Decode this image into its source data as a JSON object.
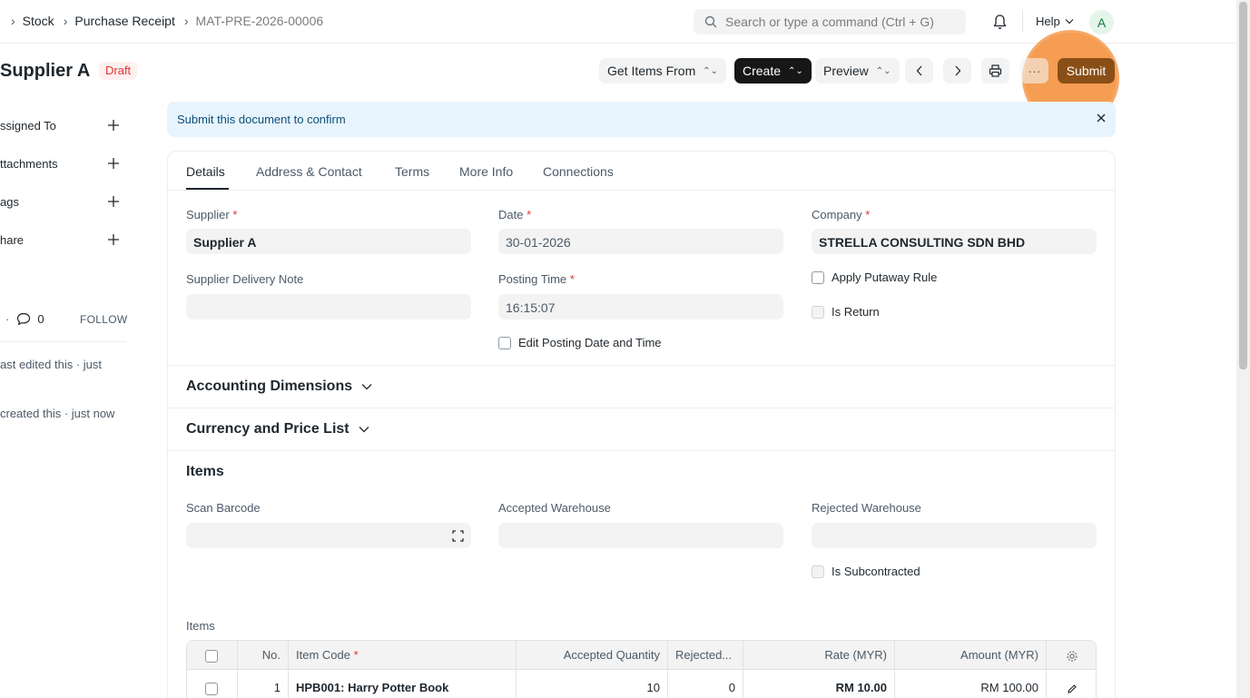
{
  "navbar": {
    "breadcrumbs": [
      "Stock",
      "Purchase Receipt",
      "MAT-PRE-2026-00006"
    ],
    "search_placeholder": "Search or type a command (Ctrl + G)",
    "help_label": "Help",
    "avatar_initial": "A"
  },
  "page": {
    "title": "Supplier A",
    "status": "Draft",
    "actions": {
      "get_items": "Get Items From",
      "create": "Create",
      "preview": "Preview",
      "more": "···",
      "submit": "Submit"
    }
  },
  "sidebar": {
    "items": [
      "ssigned To",
      "ttachments",
      "ags",
      "hare"
    ],
    "comment_count": "0",
    "follow": "FOLLOW",
    "activity": [
      "ast edited this · just",
      "created this · just now"
    ]
  },
  "alert": {
    "message": "Submit this document to confirm"
  },
  "tabs": [
    "Details",
    "Address & Contact",
    "Terms",
    "More Info",
    "Connections"
  ],
  "details": {
    "supplier_label": "Supplier",
    "supplier_value": "Supplier A",
    "date_label": "Date",
    "date_value": "30-01-2026",
    "company_label": "Company",
    "company_value": "STRELLA CONSULTING SDN BHD",
    "delivery_note_label": "Supplier Delivery Note",
    "delivery_note_value": "",
    "posting_time_label": "Posting Time",
    "posting_time_value": "16:15:07",
    "apply_putaway_label": "Apply Putaway Rule",
    "is_return_label": "Is Return",
    "edit_posting_label": "Edit Posting Date and Time",
    "required_mark": "*"
  },
  "sections": {
    "accounting": "Accounting Dimensions",
    "currency": "Currency and Price List",
    "items": "Items"
  },
  "items_section": {
    "scan_barcode_label": "Scan Barcode",
    "accepted_wh_label": "Accepted Warehouse",
    "rejected_wh_label": "Rejected Warehouse",
    "subcontracted_label": "Is Subcontracted",
    "table_label": "Items"
  },
  "items_table": {
    "columns": [
      "No.",
      "Item Code",
      "Accepted Quantity",
      "Rejected...",
      "Rate (MYR)",
      "Amount (MYR)"
    ],
    "rows": [
      {
        "no": "1",
        "item_code": "HPB001: Harry Potter Book",
        "accepted_qty": "10",
        "rejected_qty": "0",
        "rate": "RM 10.00",
        "amount": "RM 100.00"
      }
    ]
  }
}
